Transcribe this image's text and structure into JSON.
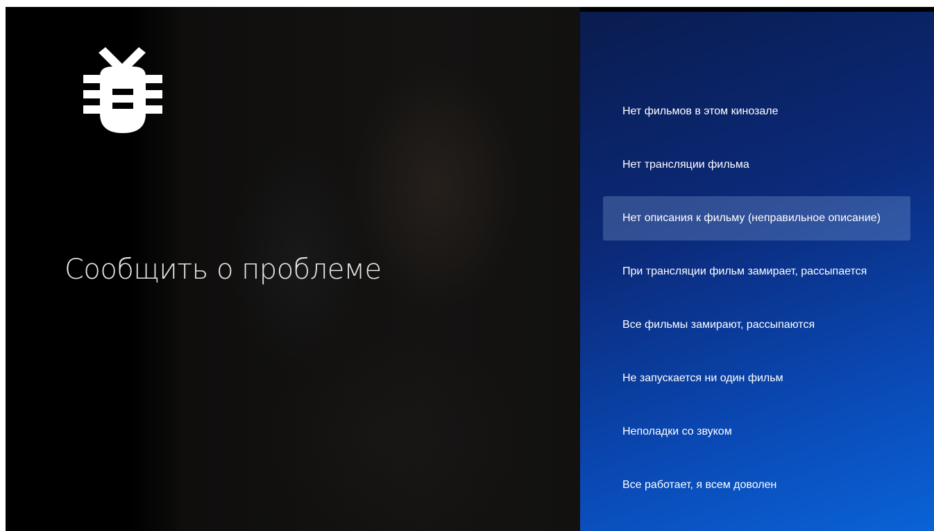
{
  "screen": {
    "title": "Сообщить о проблеме",
    "icon": "bug-icon"
  },
  "menu": {
    "items": [
      {
        "label": "Нет фильмов в этом кинозале",
        "focused": false
      },
      {
        "label": "Нет трансляции фильма",
        "focused": false
      },
      {
        "label": "Нет описания к фильму (неправильное описание)",
        "focused": true
      },
      {
        "label": "При трансляции фильм замирает, рассыпается",
        "focused": false
      },
      {
        "label": "Все фильмы замирают, рассыпаются",
        "focused": false
      },
      {
        "label": "Не запускается ни один фильм",
        "focused": false
      },
      {
        "label": "Неполадки со звуком",
        "focused": false
      },
      {
        "label": "Все работает, я всем доволен",
        "focused": false
      }
    ]
  },
  "colors": {
    "panel_gradient_start": "#0a1c4f",
    "panel_gradient_end": "#0a63d6",
    "focus_highlight": "#5f7fb3",
    "text": "#ffffff",
    "background": "#000000"
  }
}
